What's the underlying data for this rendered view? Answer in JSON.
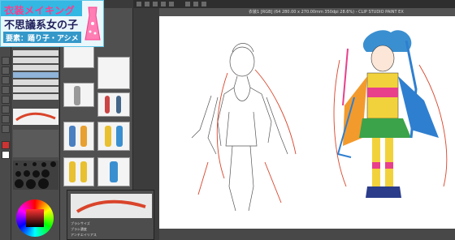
{
  "card": {
    "title_line1": "衣装メイキング",
    "title_line2": "不思議系女の子",
    "subtitle": "要素：踊り子・アシメ"
  },
  "window": {
    "title": "衣装1 [RGB] (64 280.00 x 270.00mm 350dpi 28.6%) - CLIP STUDIO PAINT EX"
  },
  "popup": {
    "items": [
      "ブラシサイズ",
      "ブラシ濃度",
      "アンチエイリアス"
    ]
  },
  "colors": {
    "accent": "#33b7e3",
    "pink": "#ff3b8c",
    "sketch_red": "#d9442a"
  }
}
